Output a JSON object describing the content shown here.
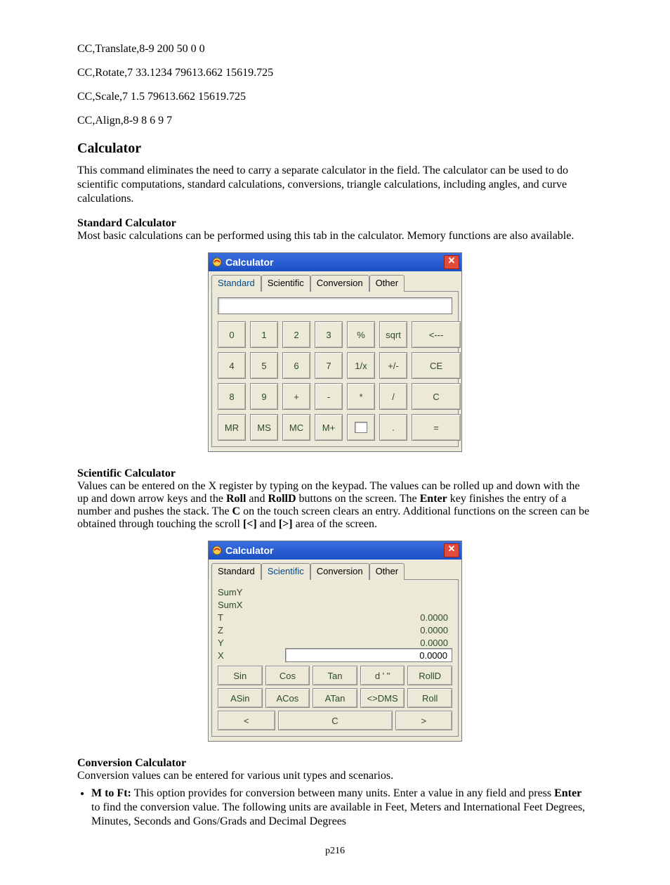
{
  "commands": [
    "CC,Translate,8-9 200 50 0 0",
    "CC,Rotate,7 33.1234 79613.662 15619.725",
    "CC,Scale,7 1.5 79613.662 15619.725",
    "CC,Align,8-9 8 6 9 7"
  ],
  "heading": "Calculator",
  "intro": "This command eliminates the need to carry a separate calculator in the field. The calculator can be used to do scientific computations, standard calculations, conversions, triangle calculations, including angles, and curve calculations.",
  "standard": {
    "title": "Standard Calculator",
    "desc": "Most basic calculations can be performed using this tab in the calculator. Memory functions are also available."
  },
  "scientific": {
    "title": "Scientific Calculator",
    "desc_parts": {
      "p1": "Values can be entered on the X register by typing on the keypad. The values can be rolled up and down with the up and down arrow keys and the ",
      "b1": "Roll",
      "p2": " and ",
      "b2": "RollD",
      "p3": " buttons on the screen. The ",
      "b3": "Enter",
      "p4": " key finishes the entry of a number and pushes the stack. The ",
      "b4": "C",
      "p5": " on the touch screen clears an entry. Additional functions on the screen can be obtained through touching the scroll ",
      "b5": "[<]",
      "p6": " and ",
      "b6": "[>]",
      "p7": " area of the screen."
    }
  },
  "conversion": {
    "title": "Conversion Calculator",
    "desc": "Conversion values can be entered for various unit types and scenarios.",
    "bullet": {
      "lead": "M to Ft:",
      "rest_a": " This option provides for conversion between many units. Enter a value in any field and press ",
      "enter": "Enter",
      "rest_b": " to find the conversion value.  The following units are available in Feet, Meters and International Feet Degrees, Minutes, Seconds and Gons/Grads and Decimal Degrees"
    }
  },
  "calc": {
    "title": "Calculator",
    "tabs": [
      "Standard",
      "Scientific",
      "Conversion",
      "Other"
    ],
    "std_keys": [
      [
        "0",
        "1",
        "2",
        "3",
        "%",
        "sqrt",
        "<---"
      ],
      [
        "4",
        "5",
        "6",
        "7",
        "1/x",
        "+/-",
        "CE"
      ],
      [
        "8",
        "9",
        "+",
        "-",
        "*",
        "/",
        "C"
      ],
      [
        "MR",
        "MS",
        "MC",
        "M+",
        "[box]",
        ".",
        "="
      ]
    ],
    "sci": {
      "registers": [
        {
          "label": "SumY",
          "value": ""
        },
        {
          "label": "SumX",
          "value": ""
        },
        {
          "label": "T",
          "value": "0.0000"
        },
        {
          "label": "Z",
          "value": "0.0000"
        },
        {
          "label": "Y",
          "value": "0.0000"
        }
      ],
      "x_label": "X",
      "x_value": "0.0000",
      "row1": [
        "Sin",
        "Cos",
        "Tan",
        "d ' \"",
        "RollD"
      ],
      "row2": [
        "ASin",
        "ACos",
        "ATan",
        "<>DMS",
        "Roll"
      ],
      "bottom": [
        "<",
        "C",
        ">"
      ]
    }
  },
  "page": "p216"
}
